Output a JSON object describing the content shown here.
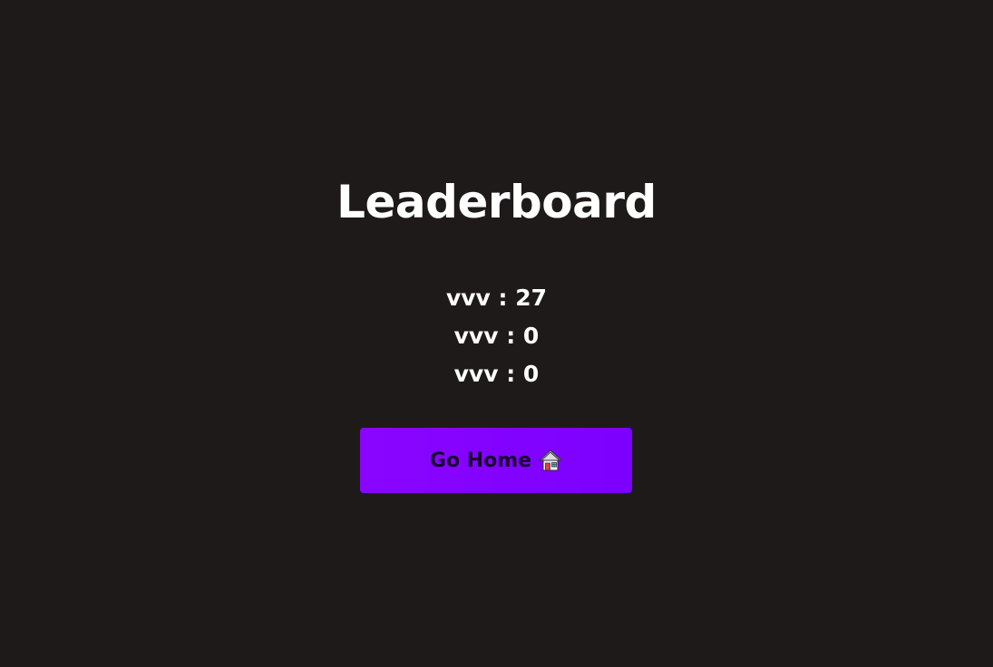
{
  "page": {
    "title": "Leaderboard"
  },
  "leaderboard": {
    "entries": [
      {
        "text": "vvv : 27"
      },
      {
        "text": "vvv : 0"
      },
      {
        "text": "vvv : 0"
      }
    ]
  },
  "home_button": {
    "label": "Go Home",
    "icon": "house-icon"
  },
  "colors": {
    "background": "#1e1a1a",
    "text": "#ffffff",
    "button": "#8000ff",
    "button_text": "#1a0030"
  }
}
